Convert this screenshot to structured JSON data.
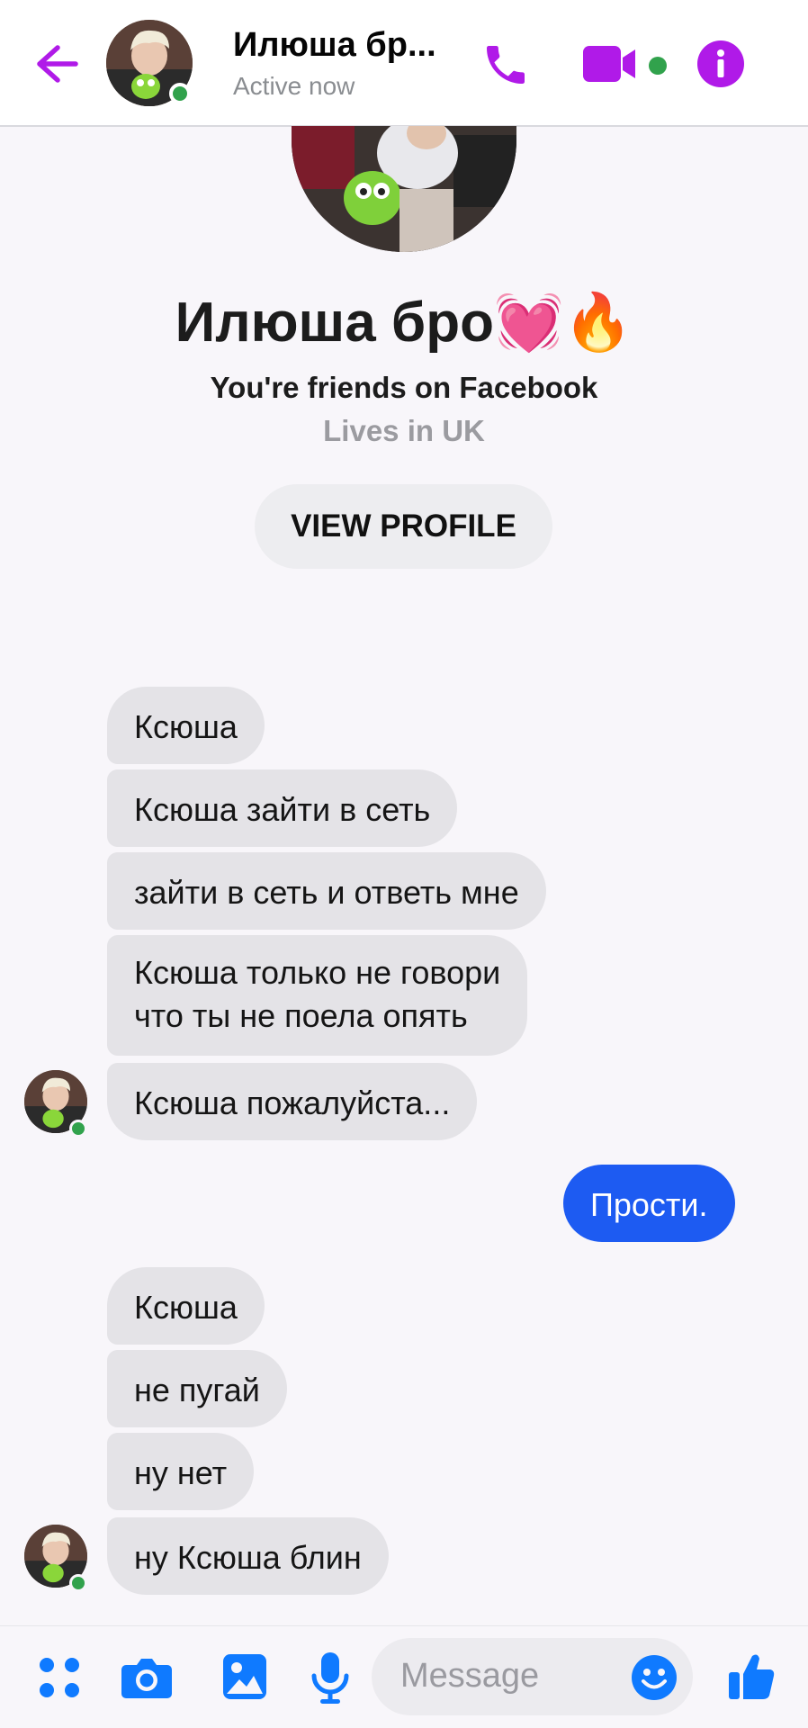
{
  "colors": {
    "accent": "#b01ae8",
    "online": "#31a24c",
    "sent_bubble": "#1d5bf2",
    "received_bubble": "#e4e3e7",
    "icon_blue": "#0f7aff"
  },
  "header": {
    "title": "Илюша бр...",
    "status": "Active now",
    "icons": [
      "back-arrow-icon",
      "phone-icon",
      "video-camera-icon",
      "info-icon"
    ]
  },
  "profile": {
    "name": "Илюша бро💓🔥",
    "relation": "You're friends on Facebook",
    "location": "Lives in UK",
    "view_profile_label": "VIEW PROFILE"
  },
  "messages": [
    {
      "from": "them",
      "text": "Ксюша"
    },
    {
      "from": "them",
      "text": "Ксюша зайти в сеть"
    },
    {
      "from": "them",
      "text": "зайти в сеть и ответь мне"
    },
    {
      "from": "them",
      "lines": [
        "Ксюша только не говори",
        "что ты не поела опять"
      ]
    },
    {
      "from": "them",
      "text": "Ксюша пожалуйста..."
    },
    {
      "from": "me",
      "text": "Прости."
    },
    {
      "from": "them",
      "text": "Ксюша"
    },
    {
      "from": "them",
      "text": "не пугай"
    },
    {
      "from": "them",
      "text": "ну нет"
    },
    {
      "from": "them",
      "text": "ну Ксюша блин"
    }
  ],
  "composer": {
    "placeholder": "Message",
    "icons": [
      "apps-menu-icon",
      "camera-icon",
      "gallery-icon",
      "microphone-icon",
      "emoji-icon",
      "thumbs-up-icon"
    ]
  }
}
